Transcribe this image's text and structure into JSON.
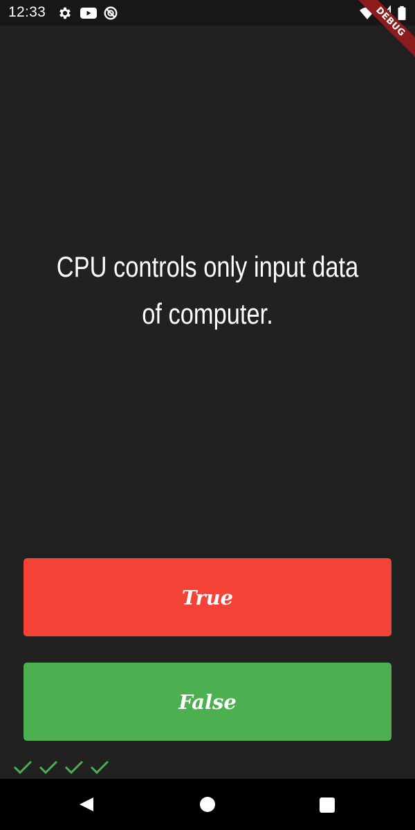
{
  "status_bar": {
    "time": "12:33",
    "icons": [
      "gear-icon",
      "youtube-icon",
      "data-saver-icon",
      "wifi-icon",
      "signal-icon",
      "battery-icon"
    ]
  },
  "debug_banner": {
    "label": "DEBUG"
  },
  "quiz": {
    "question": "CPU controls only input data of computer.",
    "true_label": "True",
    "false_label": "False",
    "true_color": "#f44336",
    "false_color": "#4caf50",
    "score": [
      {
        "icon": "check-icon",
        "color": "#4caf50"
      },
      {
        "icon": "check-icon",
        "color": "#4caf50"
      },
      {
        "icon": "check-icon",
        "color": "#4caf50"
      },
      {
        "icon": "check-icon",
        "color": "#4caf50"
      }
    ]
  },
  "nav_bar": {
    "icons": [
      "back-icon",
      "home-icon",
      "recents-icon"
    ]
  }
}
